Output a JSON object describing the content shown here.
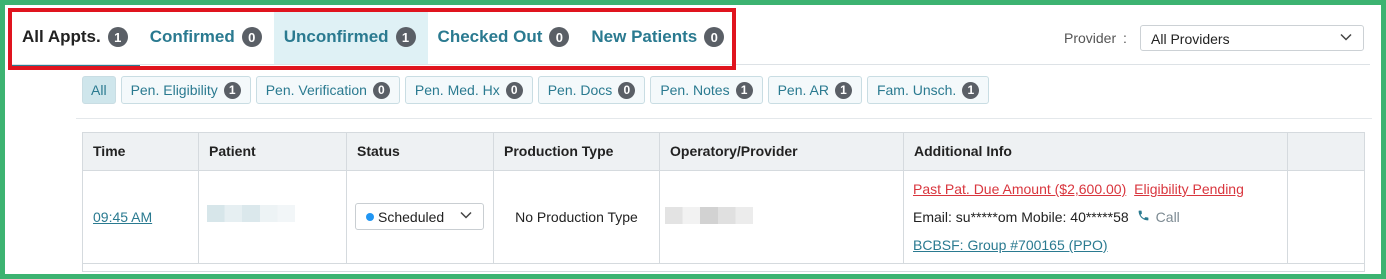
{
  "tabs": [
    {
      "label": "All Appts.",
      "count": "1"
    },
    {
      "label": "Confirmed",
      "count": "0"
    },
    {
      "label": "Unconfirmed",
      "count": "1"
    },
    {
      "label": "Checked Out",
      "count": "0"
    },
    {
      "label": "New Patients",
      "count": "0"
    }
  ],
  "provider": {
    "label": "Provider",
    "colon": ":",
    "selected": "All Providers"
  },
  "chips": [
    {
      "label": "All"
    },
    {
      "label": "Pen. Eligibility",
      "count": "1"
    },
    {
      "label": "Pen. Verification",
      "count": "0"
    },
    {
      "label": "Pen. Med. Hx",
      "count": "0"
    },
    {
      "label": "Pen. Docs",
      "count": "0"
    },
    {
      "label": "Pen. Notes",
      "count": "1"
    },
    {
      "label": "Pen. AR",
      "count": "1"
    },
    {
      "label": "Fam. Unsch.",
      "count": "1"
    }
  ],
  "table": {
    "headers": [
      "Time",
      "Patient",
      "Status",
      "Production Type",
      "Operatory/Provider",
      "Additional Info"
    ],
    "rows": [
      {
        "time": "09:45 AM",
        "status": "Scheduled",
        "production_type": "No Production Type",
        "info": {
          "due_amount": "Past Pat. Due Amount ($2,600.00)",
          "eligibility": "Eligibility Pending",
          "email": "Email: su*****om",
          "mobile": "Mobile: 40*****58",
          "call": "Call",
          "insurance": "BCBSF: Group #700165 (PPO)"
        }
      }
    ]
  },
  "colors": {
    "accent": "#2a7a90",
    "frame": "#3cb371",
    "highlight": "#e0141e",
    "alert": "#d9363e",
    "status_dot": "#2196f3"
  }
}
